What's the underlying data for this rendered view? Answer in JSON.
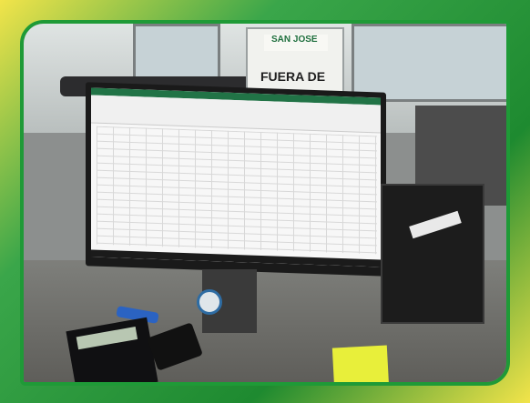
{
  "sign": {
    "logo_text": "SAN JOSE",
    "main_text": "FUERA DE"
  },
  "scene": {
    "frame_color": "#1f9a37",
    "frame_accent": "#f2e44a",
    "excel_green": "#217346"
  }
}
